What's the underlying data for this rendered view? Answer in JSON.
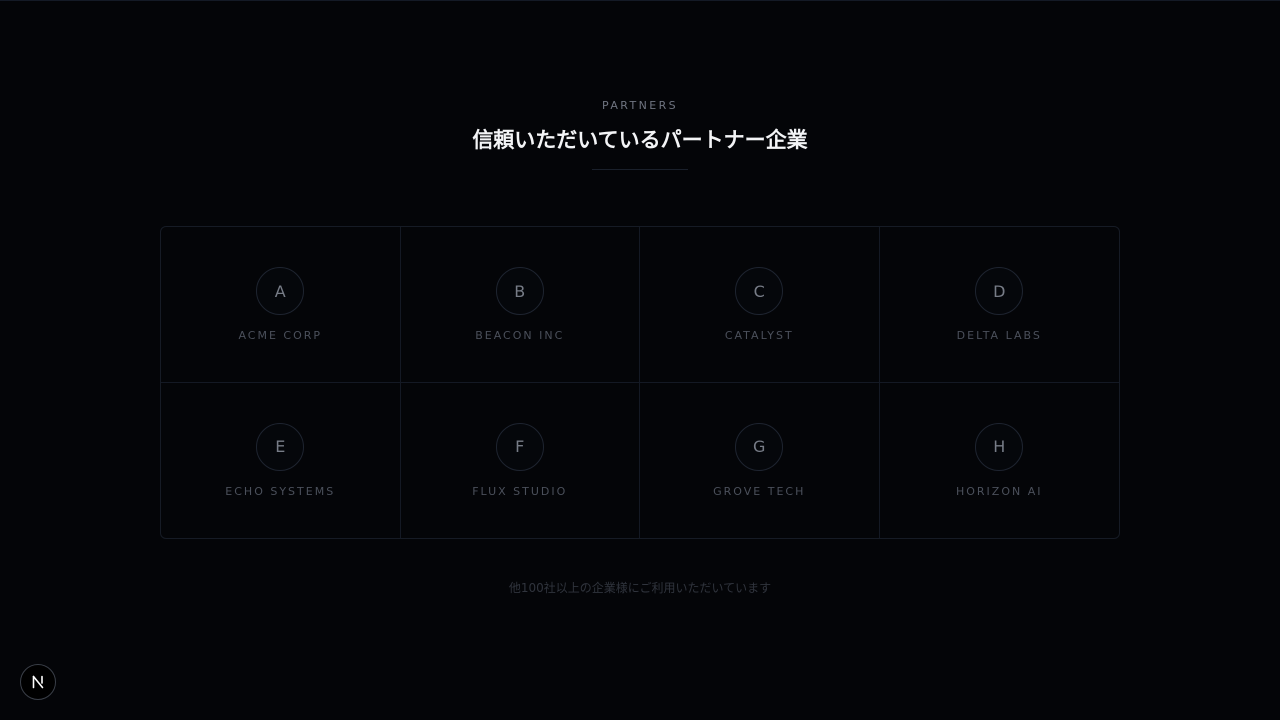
{
  "section": {
    "eyebrow": "PARTNERS",
    "title": "信頼いただいているパートナー企業",
    "footnote": "他100社以上の企業様にご利用いただいています"
  },
  "partners": [
    {
      "initial": "A",
      "name": "ACME CORP"
    },
    {
      "initial": "B",
      "name": "BEACON INC"
    },
    {
      "initial": "C",
      "name": "CATALYST"
    },
    {
      "initial": "D",
      "name": "DELTA LABS"
    },
    {
      "initial": "E",
      "name": "ECHO SYSTEMS"
    },
    {
      "initial": "F",
      "name": "FLUX STUDIO"
    },
    {
      "initial": "G",
      "name": "GROVE TECH"
    },
    {
      "initial": "H",
      "name": "HORIZON AI"
    }
  ],
  "devtools": {
    "icon": "nextjs-n-icon"
  }
}
